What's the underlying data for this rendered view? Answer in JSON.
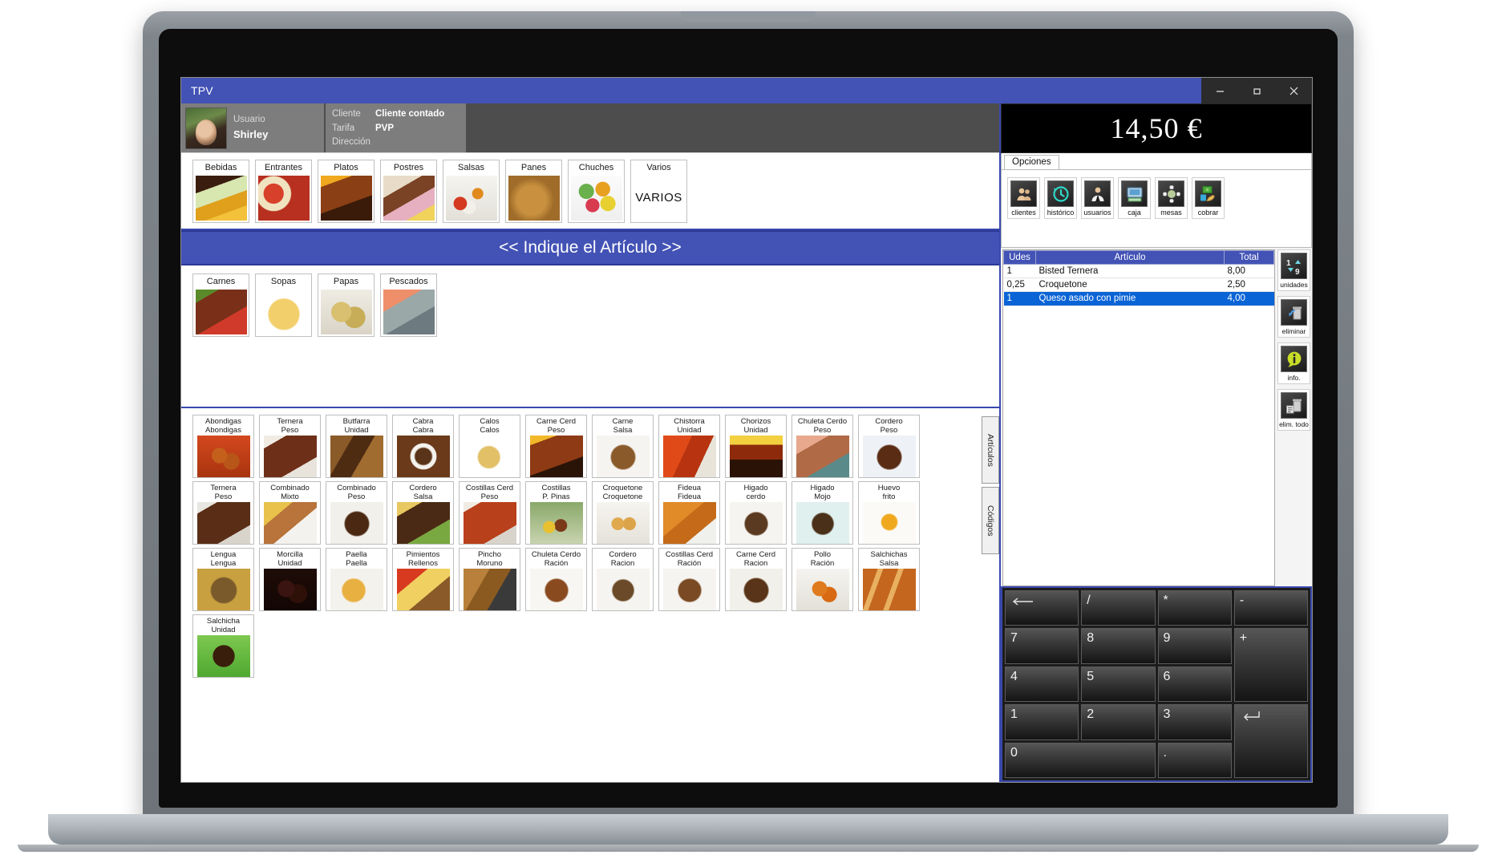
{
  "window": {
    "title": "TPV",
    "controls": [
      {
        "name": "minimize",
        "glyph": "–"
      },
      {
        "name": "restore",
        "glyph": "❐"
      },
      {
        "name": "close",
        "glyph": "✕"
      }
    ]
  },
  "header": {
    "user_label": "Usuario",
    "user_name": "Shirley",
    "client_rows": [
      {
        "key": "Cliente",
        "value": "Cliente contado"
      },
      {
        "key": "Tarifa",
        "value": "PVP"
      },
      {
        "key": "Dirección",
        "value": ""
      }
    ]
  },
  "total": {
    "amount": "14,50 €"
  },
  "options": {
    "tab_label": "Opciones",
    "buttons": [
      {
        "label": "clientes",
        "icon": "clients-icon"
      },
      {
        "label": "histórico",
        "icon": "history-clock-icon"
      },
      {
        "label": "usuarios",
        "icon": "waiter-user-icon"
      },
      {
        "label": "caja",
        "icon": "cash-register-icon"
      },
      {
        "label": "mesas",
        "icon": "tables-icon"
      },
      {
        "label": "cobrar",
        "icon": "payment-money-icon"
      }
    ]
  },
  "categories": [
    {
      "label": "Bebidas",
      "thumb": "drinks"
    },
    {
      "label": "Entrantes",
      "thumb": "starters"
    },
    {
      "label": "Platos",
      "thumb": "mains"
    },
    {
      "label": "Postres",
      "thumb": "desserts"
    },
    {
      "label": "Salsas",
      "thumb": "sauces"
    },
    {
      "label": "Panes",
      "thumb": "breads"
    },
    {
      "label": "Chuches",
      "thumb": "sweets"
    },
    {
      "label": "Varios",
      "thumb": "",
      "text_only": "VARIOS"
    }
  ],
  "banner": {
    "text": "<< Indique el Artículo >>"
  },
  "subcategories": [
    {
      "label": "Carnes",
      "thumb": "meat"
    },
    {
      "label": "Sopas",
      "thumb": "soup"
    },
    {
      "label": "Papas",
      "thumb": "potatoes"
    },
    {
      "label": "Pescados",
      "thumb": "fish"
    }
  ],
  "side_tabs": [
    {
      "label": "Artículos"
    },
    {
      "label": "Códigos"
    }
  ],
  "products": [
    {
      "line1": "Abondigas",
      "line2": "Abondigas",
      "thumb": "meatballs"
    },
    {
      "line1": "Ternera",
      "line2": "Peso",
      "thumb": "steak"
    },
    {
      "line1": "Butfarra",
      "line2": "Unidad",
      "thumb": "sausage-grill"
    },
    {
      "line1": "Cabra",
      "line2": "Cabra",
      "thumb": "stew-plate"
    },
    {
      "line1": "Calos",
      "line2": "Calos",
      "thumb": "tripe"
    },
    {
      "line1": "Carne Cerd",
      "line2": "Peso",
      "thumb": "ribs-grill"
    },
    {
      "line1": "Carne",
      "line2": "Salsa",
      "thumb": "meat-sauce"
    },
    {
      "line1": "Chistorra",
      "line2": "Unidad",
      "thumb": "chistorra"
    },
    {
      "line1": "Chorizos",
      "line2": "Unidad",
      "thumb": "chorizo-fire"
    },
    {
      "line1": "Chuleta Cerdo",
      "line2": "Peso",
      "thumb": "pork-chop"
    },
    {
      "line1": "Cordero",
      "line2": "Peso",
      "thumb": "lamb-rack"
    },
    {
      "line1": "Ternera",
      "line2": "Peso",
      "thumb": "tbone"
    },
    {
      "line1": "Combinado",
      "line2": "Mixto",
      "thumb": "combo-fries"
    },
    {
      "line1": "Combinado",
      "line2": "Peso",
      "thumb": "combo-pan"
    },
    {
      "line1": "Cordero",
      "line2": "Salsa",
      "thumb": "lamb-sauce"
    },
    {
      "line1": "Costillas Cerd",
      "line2": "Peso",
      "thumb": "ribs-bbq"
    },
    {
      "line1": "Costillas",
      "line2": "P. Pinas",
      "thumb": "ribs-plated"
    },
    {
      "line1": "Croquetone",
      "line2": "Croquetone",
      "thumb": "croquettes"
    },
    {
      "line1": "Fideua",
      "line2": "Fideua",
      "thumb": "fideua"
    },
    {
      "line1": "Higado",
      "line2": "cerdo",
      "thumb": "liver-pork"
    },
    {
      "line1": "Higado",
      "line2": "Mojo",
      "thumb": "liver-mojo"
    },
    {
      "line1": "Huevo",
      "line2": "frito",
      "thumb": "fried-egg"
    },
    {
      "line1": "Lengua",
      "line2": "Lengua",
      "thumb": "tongue"
    },
    {
      "line1": "Morcilla",
      "line2": "Unidad",
      "thumb": "morcilla"
    },
    {
      "line1": "Paella",
      "line2": "Paella",
      "thumb": "paella"
    },
    {
      "line1": "Pimientos",
      "line2": "Rellenos",
      "thumb": "stuffed-peppers"
    },
    {
      "line1": "Pincho",
      "line2": "Moruno",
      "thumb": "skewers"
    },
    {
      "line1": "Chuleta Cerdo",
      "line2": "Ración",
      "thumb": "chop-ration"
    },
    {
      "line1": "Cordero",
      "line2": "Racion",
      "thumb": "lamb-ration"
    },
    {
      "line1": "Costillas Cerd",
      "line2": "Ración",
      "thumb": "ribs-ration"
    },
    {
      "line1": "Carne Cerd",
      "line2": "Racion",
      "thumb": "pork-ration"
    },
    {
      "line1": "Pollo",
      "line2": "Ración",
      "thumb": "chicken"
    },
    {
      "line1": "Salchichas",
      "line2": "Salsa",
      "thumb": "sausages-sauce"
    },
    {
      "line1": "Salchicha",
      "line2": "Unidad",
      "thumb": "salchicha-coil"
    }
  ],
  "ticket": {
    "columns": [
      "Udes",
      "Artículo",
      "Total"
    ],
    "rows": [
      {
        "udes": "1",
        "articulo": "Bisted Ternera",
        "total": "8,00",
        "selected": false
      },
      {
        "udes": "0,25",
        "articulo": "Croquetone",
        "total": "2,50",
        "selected": false
      },
      {
        "udes": "1",
        "articulo": "Queso asado con pimie",
        "total": "4,00",
        "selected": true
      }
    ]
  },
  "ticket_actions": [
    {
      "label": "unidades",
      "icon": "units-updown-icon"
    },
    {
      "label": "eliminar",
      "icon": "trash-undo-icon"
    },
    {
      "label": "info.",
      "icon": "info-bubble-icon"
    },
    {
      "label": "elim. todo",
      "icon": "trash-all-icon"
    }
  ],
  "keypad": [
    {
      "label": "",
      "icon": "backspace-icon",
      "name": "key-backspace"
    },
    {
      "label": "/",
      "name": "key-divide"
    },
    {
      "label": "*",
      "name": "key-multiply"
    },
    {
      "label": "-",
      "name": "key-minus"
    },
    {
      "label": "7",
      "name": "key-7"
    },
    {
      "label": "8",
      "name": "key-8"
    },
    {
      "label": "9",
      "name": "key-9"
    },
    {
      "label": "+",
      "name": "key-plus",
      "tall": true
    },
    {
      "label": "4",
      "name": "key-4"
    },
    {
      "label": "5",
      "name": "key-5"
    },
    {
      "label": "6",
      "name": "key-6"
    },
    {
      "label": "1",
      "name": "key-1"
    },
    {
      "label": "2",
      "name": "key-2"
    },
    {
      "label": "3",
      "name": "key-3"
    },
    {
      "label": "",
      "icon": "enter-icon",
      "name": "key-enter",
      "tall": true
    },
    {
      "label": "0",
      "name": "key-0",
      "wide": true
    },
    {
      "label": ".",
      "name": "key-decimal"
    }
  ],
  "colors": {
    "accent_blue": "#4252b5",
    "selection_blue": "#0a64d6",
    "header_gray": "#4d4d4d",
    "panel_gray": "#7d7d7d"
  }
}
